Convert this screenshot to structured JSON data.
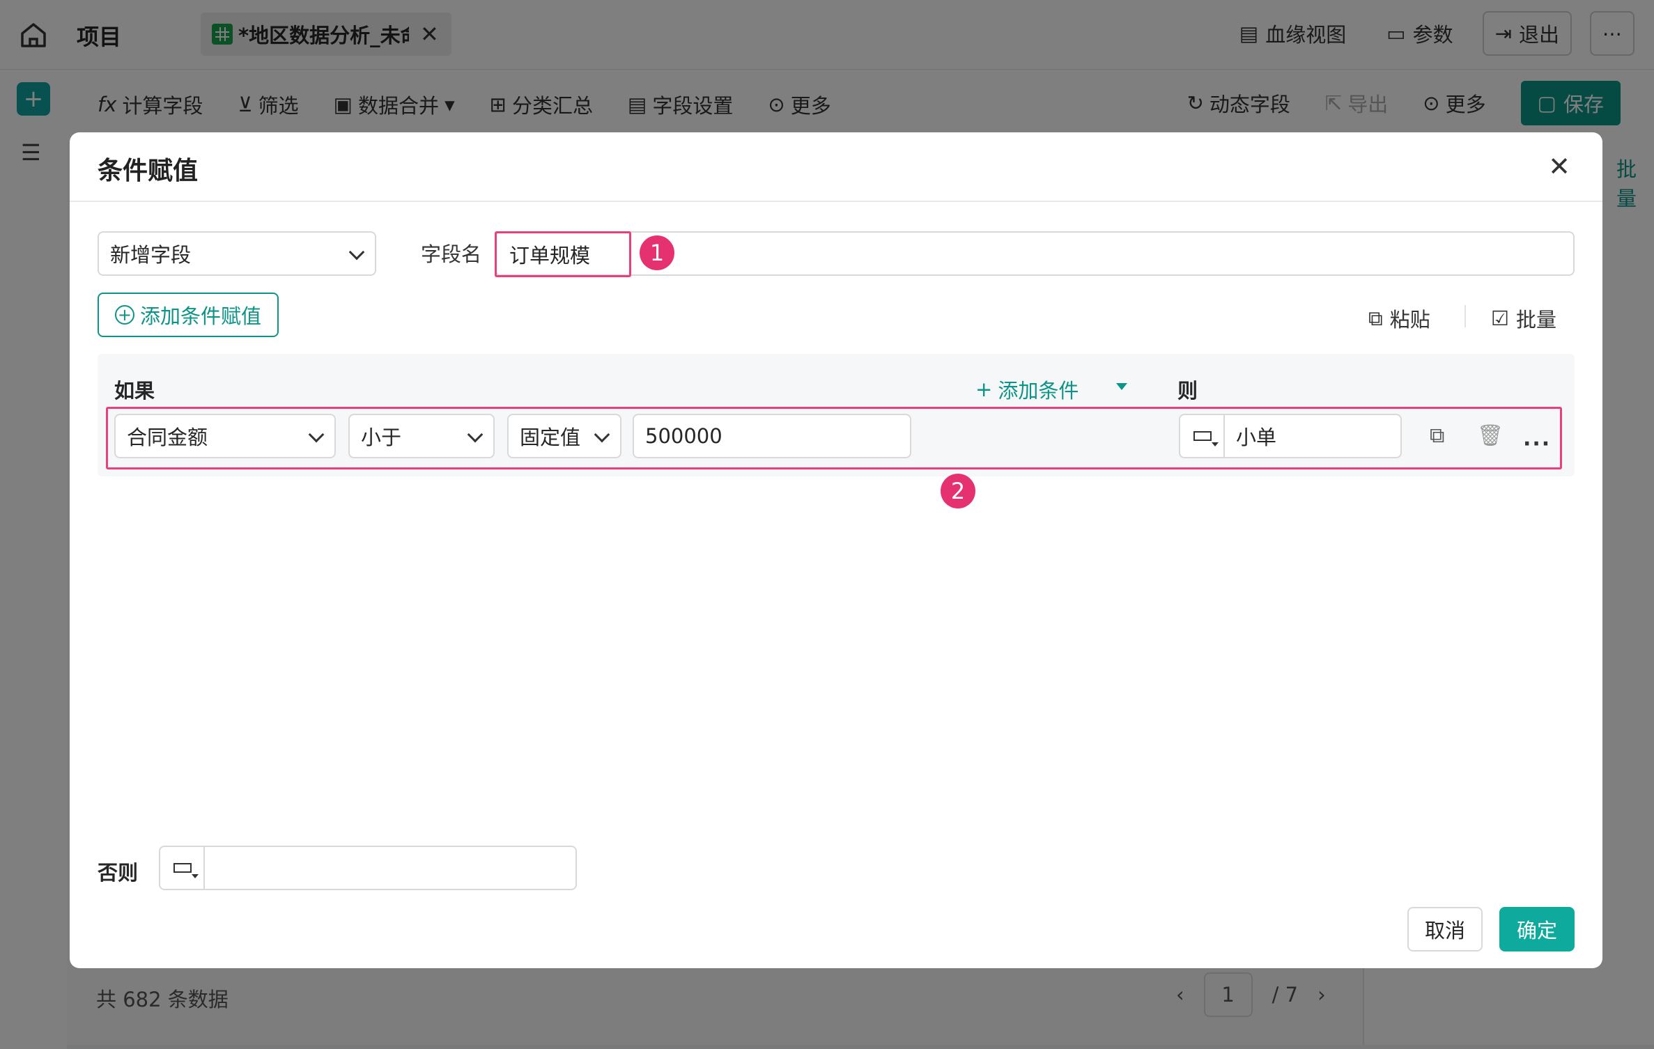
{
  "topbar": {
    "app_title": "项目",
    "file_tab": "*地区数据分析_未命名",
    "lineage": "血缘视图",
    "params": "参数",
    "exit": "退出"
  },
  "toolbar": {
    "calc_field": "计算字段",
    "filter": "筛选",
    "data_merge": "数据合并",
    "group_summary": "分类汇总",
    "field_settings": "字段设置",
    "more_left": "更多",
    "dynamic_field": "动态字段",
    "export": "导出",
    "more_right": "更多",
    "save": "保存"
  },
  "background": {
    "record_count": "共 682 条数据",
    "pager_current": "1",
    "pager_total": "/ 7",
    "side_batch": "批量"
  },
  "dialog": {
    "title": "条件赋值",
    "mode_select": "新增字段",
    "field_name_label": "字段名",
    "field_name_value": "订单规模",
    "add_condition_button": "添加条件赋值",
    "paste": "粘贴",
    "batch": "批量",
    "if_label": "如果",
    "add_condition_link": "添加条件",
    "then_label": "则",
    "condition_row": {
      "field": "合同金额",
      "operator": "小于",
      "value_type": "固定值",
      "value": "500000",
      "result": "小单"
    },
    "else_label": "否则",
    "else_value": "",
    "cancel": "取消",
    "confirm": "确定",
    "badges": [
      "1",
      "2"
    ]
  }
}
